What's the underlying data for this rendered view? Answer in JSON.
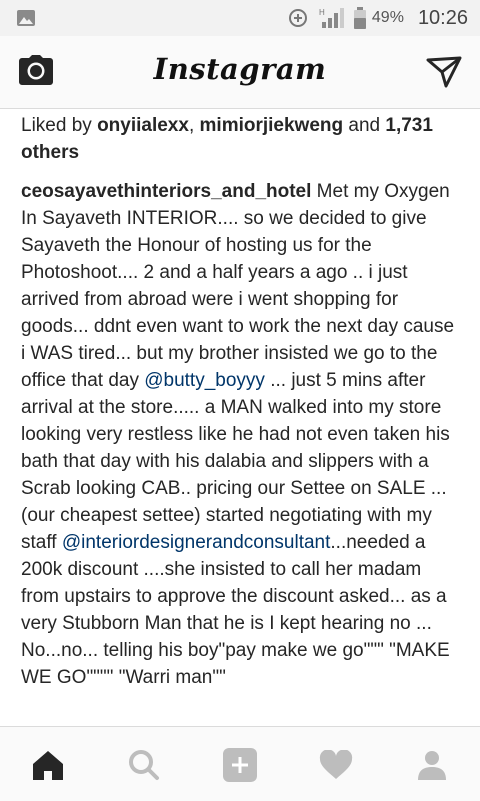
{
  "status_bar": {
    "left_icon": "image-icon",
    "battery_pct": "49%",
    "time": "10:26",
    "network_label": "H"
  },
  "header": {
    "title": "Instagram",
    "left_icon": "camera-icon",
    "right_icon": "direct-message-icon"
  },
  "post": {
    "liked_prefix": "Liked by",
    "liker1": "onyiialexx",
    "sep": ",",
    "liker2": "mimiorjiekweng",
    "and": "and",
    "others_count": "1,731",
    "others": "others",
    "username": "ceosayavethinteriors_and_hotel",
    "caption_p1": "Met my Oxygen In Sayaveth INTERIOR.... so we decided to give Sayaveth the Honour of hosting us for the Photoshoot.... 2 and a half years a ago .. i just arrived from abroad were i went shopping for goods... ddnt even want to work the next day cause i WAS tired... but my brother insisted we go to the office that day",
    "mention1": "@butty_boyyy",
    "caption_p2": "... just 5 mins after arrival at the store..... a MAN walked into my store looking very restless like he had not even taken his bath that day with his dalabia and slippers with a Scrab looking CAB.. pricing our Settee on SALE ... (our cheapest settee) started negotiating with my staff",
    "mention2": "@interiordesignerandconsultant",
    "caption_p3": "...needed a 200k discount ....she insisted to call her madam from upstairs to approve the discount asked... as a very Stubborn Man that he is I kept hearing no ... No...no... telling his boy\"pay make we go\"\"\" \"MAKE WE GO\"\"\"\" \"Warri man\"\""
  },
  "bottom_nav": {
    "items": [
      "home-icon",
      "search-icon",
      "add-post-icon",
      "heart-icon",
      "profile-icon"
    ]
  },
  "colors": {
    "mention": "#003569",
    "status_bar_bg": "#f2f2f2",
    "nav_bg": "#fafafa",
    "icon_gray": "#bdbdbd"
  }
}
